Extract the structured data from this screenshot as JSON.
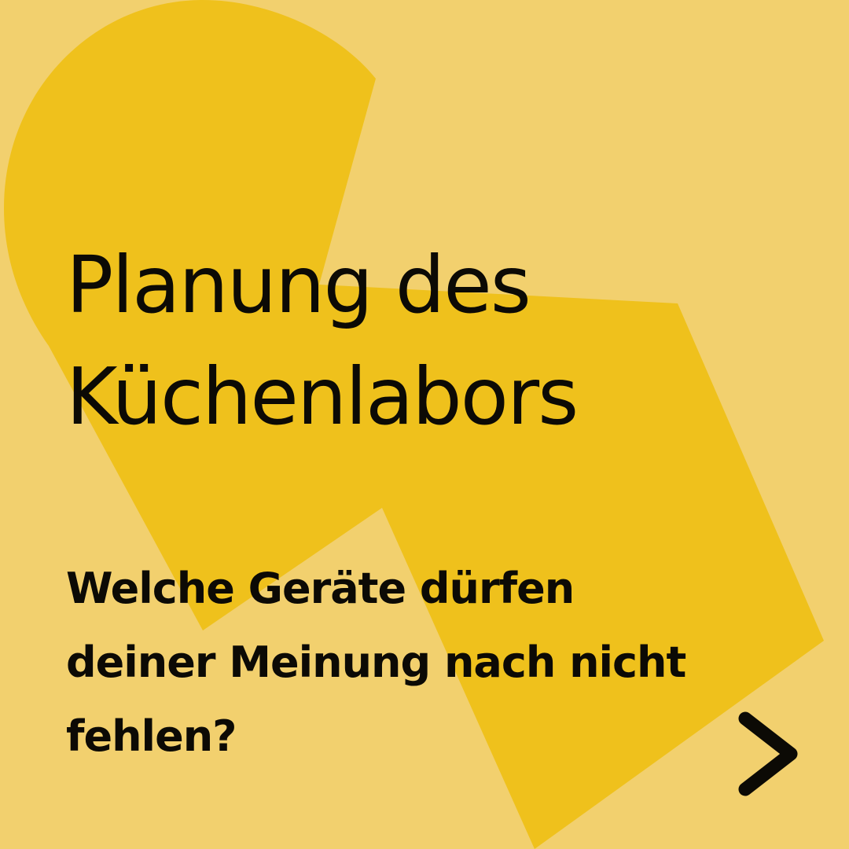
{
  "colors": {
    "background": "#f2d06e",
    "shape": "#efc11c",
    "text": "#0c0a05"
  },
  "headline": {
    "line1": "Planung des",
    "line2": "Küchenlabors"
  },
  "subline": {
    "line1": "Welche Geräte dürfen",
    "line2": "deiner Meinung nach nicht",
    "line3": "fehlen?"
  },
  "icons": {
    "next": "chevron-right-icon"
  }
}
